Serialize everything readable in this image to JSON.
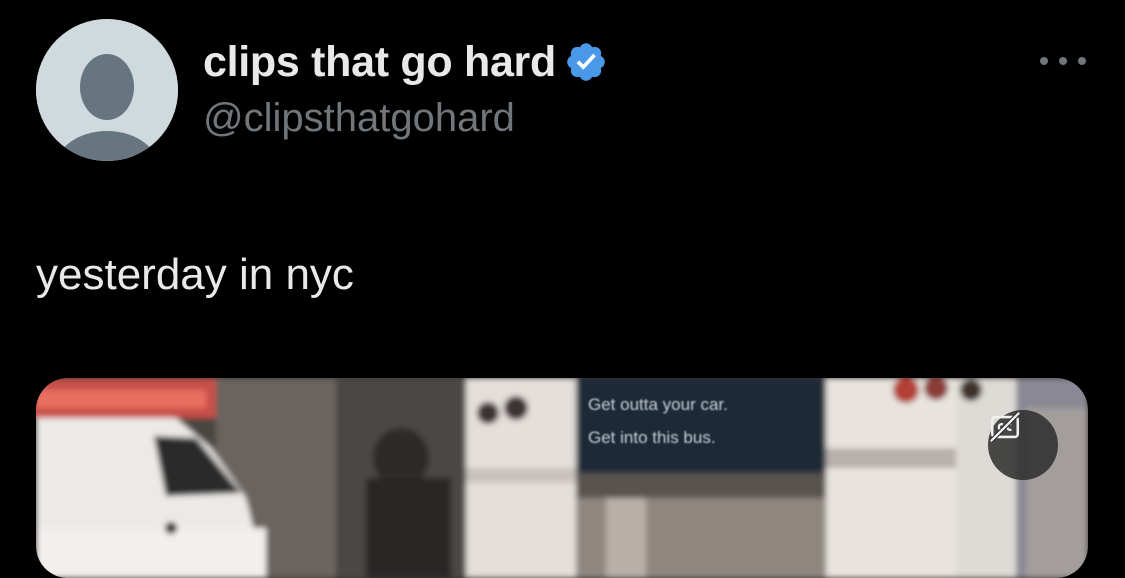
{
  "tweet": {
    "author": {
      "display_name": "clips that go hard",
      "handle": "@clipsthatgohard",
      "verified": true,
      "verified_color": "#4a99e9",
      "avatar_icon": "default-profile-icon"
    },
    "text": "yesterday in nyc",
    "more_icon": "more-horizontal-icon",
    "media": {
      "type": "video",
      "billboard_line1": "Get outta your car.",
      "billboard_line2": "Get into this bus.",
      "cc_icon": "closed-captions-off-icon"
    }
  },
  "colors": {
    "background": "#000000",
    "primary_text": "#e7e9ea",
    "secondary_text": "#71767b"
  }
}
